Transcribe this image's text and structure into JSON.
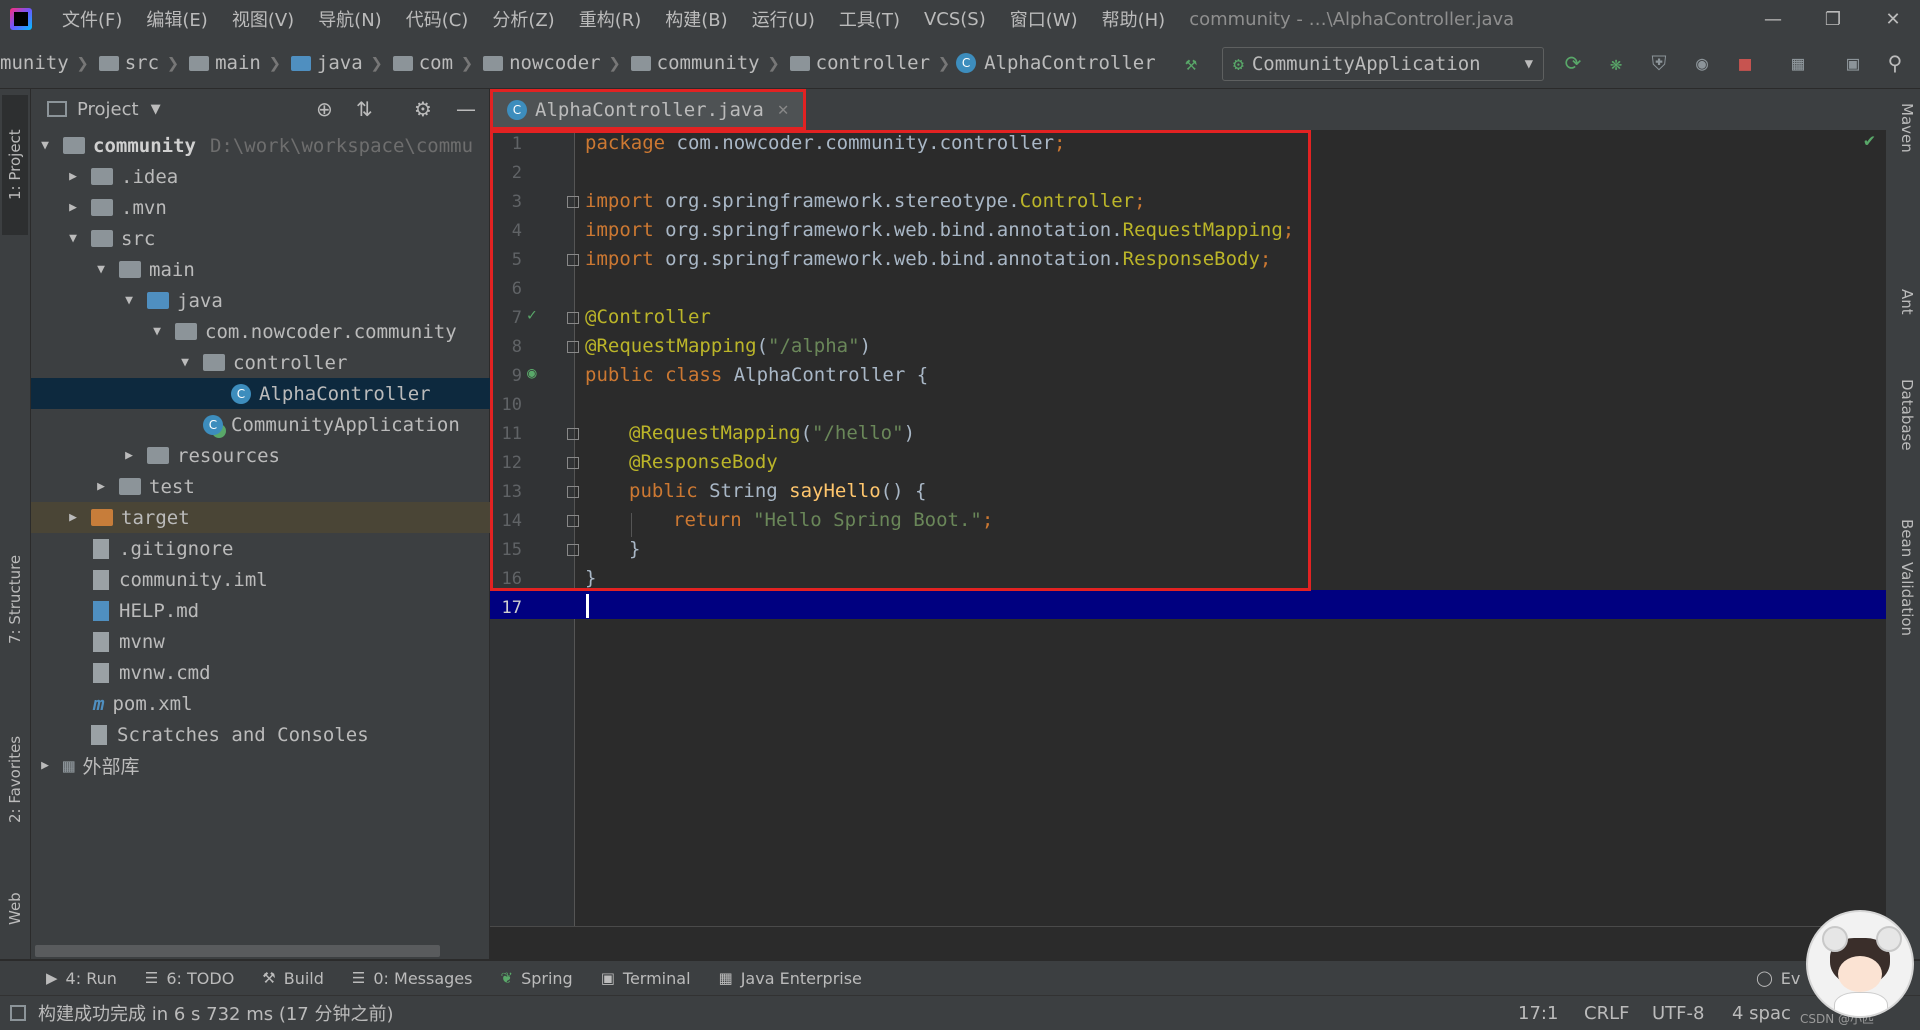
{
  "menubar": {
    "items": [
      "文件(F)",
      "编辑(E)",
      "视图(V)",
      "导航(N)",
      "代码(C)",
      "分析(Z)",
      "重构(R)",
      "构建(B)",
      "运行(U)",
      "工具(T)",
      "VCS(S)",
      "窗口(W)",
      "帮助(H)"
    ],
    "title": "community - …\\AlphaController.java"
  },
  "breadcrumbs": [
    "munity",
    "src",
    "main",
    "java",
    "com",
    "nowcoder",
    "community",
    "controller",
    "AlphaController"
  ],
  "run_config": "CommunityApplication",
  "project_panel": {
    "title": "Project",
    "tree": [
      {
        "label": "community",
        "hint": "D:\\work\\workspace\\commu"
      },
      {
        "label": ".idea"
      },
      {
        "label": ".mvn"
      },
      {
        "label": "src"
      },
      {
        "label": "main"
      },
      {
        "label": "java"
      },
      {
        "label": "com.nowcoder.community"
      },
      {
        "label": "controller"
      },
      {
        "label": "AlphaController"
      },
      {
        "label": "CommunityApplication"
      },
      {
        "label": "resources"
      },
      {
        "label": "test"
      },
      {
        "label": "target"
      },
      {
        "label": ".gitignore"
      },
      {
        "label": "community.iml"
      },
      {
        "label": "HELP.md"
      },
      {
        "label": "mvnw"
      },
      {
        "label": "mvnw.cmd"
      },
      {
        "label": "pom.xml"
      },
      {
        "label": "Scratches and Consoles"
      },
      {
        "label": "外部库"
      }
    ]
  },
  "left_stripe": {
    "project": "1: Project",
    "structure": "7: Structure",
    "favorites": "2: Favorites",
    "web": "Web"
  },
  "right_stripe": {
    "maven": "Maven",
    "ant": "Ant",
    "database": "Database",
    "bean": "Bean Validation"
  },
  "editor": {
    "tab": "AlphaController.java",
    "line_numbers": [
      "1",
      "2",
      "3",
      "4",
      "5",
      "6",
      "7",
      "8",
      "9",
      "10",
      "11",
      "12",
      "13",
      "14",
      "15",
      "16",
      "17"
    ],
    "lines": {
      "l1_kw": "package",
      "l1_rest": " com.nowcoder.community.controller",
      "l1_semi": ";",
      "l3_kw": "import",
      "l3_rest": " org.springframework.stereotype.",
      "l3_cls": "Controller",
      "l3_semi": ";",
      "l4_kw": "import",
      "l4_rest": " org.springframework.web.bind.annotation.",
      "l4_cls": "RequestMapping",
      "l4_semi": ";",
      "l5_kw": "import",
      "l5_rest": " org.springframework.web.bind.annotation.",
      "l5_cls": "ResponseBody",
      "l5_semi": ";",
      "l7": "@Controller",
      "l8_an": "@RequestMapping",
      "l8_open": "(",
      "l8_str": "\"/alpha\"",
      "l8_close": ")",
      "l9_kw": "public class",
      "l9_rest": " AlphaController {",
      "l11_an": "@RequestMapping",
      "l11_open": "(",
      "l11_str": "\"/hello\"",
      "l11_close": ")",
      "l12": "@ResponseBody",
      "l13_kw": "public",
      "l13_type": " String ",
      "l13_fn": "sayHello",
      "l13_rest": "() {",
      "l14_kw": "return",
      "l14_str": " \"Hello Spring Boot.\"",
      "l14_semi": ";",
      "l15": "}",
      "l16": "}"
    }
  },
  "tool_windows": [
    {
      "label": "4: Run"
    },
    {
      "label": "6: TODO"
    },
    {
      "label": "Build"
    },
    {
      "label": "0: Messages"
    },
    {
      "label": "Spring"
    },
    {
      "label": "Terminal"
    },
    {
      "label": "Java Enterprise"
    },
    {
      "label": "Ev"
    }
  ],
  "status": {
    "message": "构建成功完成 in 6 s 732 ms (17 分钟之前)",
    "position": "17:1",
    "line_sep": "CRLF",
    "encoding": "UTF-8",
    "indent": "4 spac",
    "watermark": "CSDN @小匹"
  }
}
